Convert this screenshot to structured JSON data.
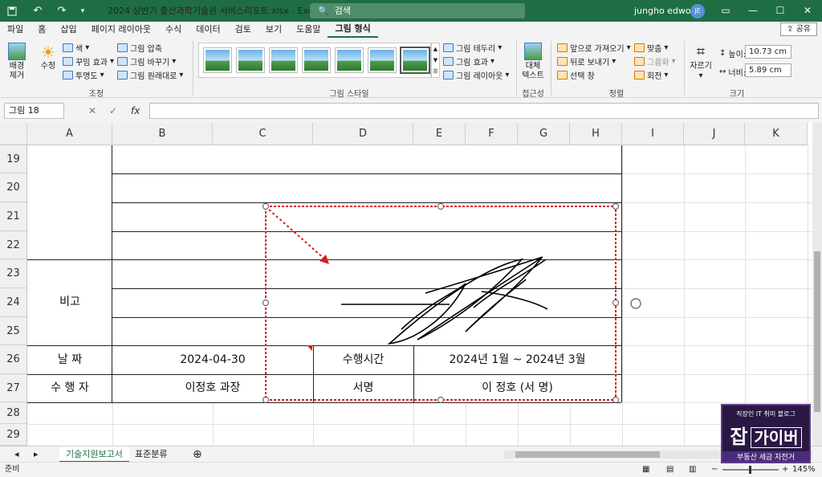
{
  "titlebar": {
    "title": "2024 상반기 출산과학기술원 서비스리포트.xlsx  -  Excel",
    "search_placeholder": "검색",
    "user_name": "jungho edword",
    "user_initials": "JE",
    "autosave_icon": "save-icon",
    "undo_icon": "undo-icon",
    "redo_icon": "redo-icon"
  },
  "menu": {
    "tabs": [
      "파일",
      "홈",
      "삽입",
      "페이지 레이아웃",
      "수식",
      "데이터",
      "검토",
      "보기",
      "도움말",
      "그림 형식"
    ],
    "active_tab": "그림 형식",
    "share_label": "공유"
  },
  "ribbon": {
    "adjust": {
      "remove_bg": "배경\n제거",
      "corrections": "수정",
      "color": "색",
      "artistic": "꾸밈 효과",
      "transparency": "투명도",
      "compress": "그림 압축",
      "change": "그림 바꾸기",
      "reset": "그림 원래대로",
      "group_label": "조정"
    },
    "styles": {
      "border": "그림 테두리",
      "effects": "그림 효과",
      "layout": "그림 레이아웃",
      "group_label": "그림 스타일"
    },
    "accessibility": {
      "alt_text": "대체\n텍스트",
      "group_label": "접근성"
    },
    "arrange": {
      "bring_forward": "앞으로 가져오기",
      "send_backward": "뒤로 보내기",
      "selection_pane": "선택 창",
      "align": "맞춤",
      "group": "그룹화",
      "rotate": "회전",
      "group_label": "정렬"
    },
    "size": {
      "crop": "자르기",
      "height_label": "높이:",
      "height": "10.73 cm",
      "width_label": "너비:",
      "width": "5.89 cm",
      "group_label": "크기"
    }
  },
  "formula": {
    "name_box": "그림 18",
    "value": ""
  },
  "columns": [
    "A",
    "B",
    "C",
    "D",
    "E",
    "F",
    "G",
    "H",
    "I",
    "J",
    "K"
  ],
  "rows": [
    "19",
    "20",
    "21",
    "22",
    "23",
    "24",
    "25",
    "26",
    "27",
    "28",
    "29"
  ],
  "cells": {
    "remark_label": "비고",
    "date_label": "날        짜",
    "date_value": "2024-04-30",
    "duration_label": "수행시간",
    "duration_value": "2024년 1월 ~ 2024년 3월",
    "performer_label": "수   행   자",
    "performer_value": "이정호 과장",
    "sign_label": "서명",
    "sign_value": "이 정호        (서   명)"
  },
  "sheets": [
    "기술지원보고서",
    "표준분류"
  ],
  "active_sheet": "기술지원보고서",
  "status": {
    "mode": "준비",
    "zoom": "145%"
  },
  "watermark": {
    "line1": "직장인 IT 취미 블로그",
    "big1": "잡",
    "big2": "가이버",
    "line2": "부동산 세금 자전거"
  },
  "colors": {
    "excel_green": "#1f6e43",
    "selection_red": "#d91e1e"
  }
}
